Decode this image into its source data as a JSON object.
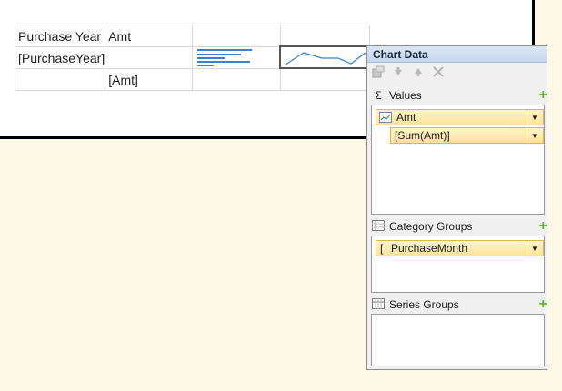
{
  "tablix": {
    "header": {
      "year": "Purchase Year",
      "amt": "Amt"
    },
    "row_group": {
      "year_expr": "[PurchaseYear]"
    },
    "detail": {
      "amt_expr": "[Amt]"
    }
  },
  "chart_data_panel": {
    "title": "Chart Data",
    "toolbar_icons": [
      "properties-icon",
      "move-down-icon",
      "move-up-icon",
      "delete-icon"
    ],
    "values": {
      "label": "Values",
      "field_name": "Amt",
      "field_expr": "[Sum(Amt)]"
    },
    "category_groups": {
      "label": "Category Groups",
      "field_prefix": "[",
      "field_name": "PurchaseMonth"
    },
    "series_groups": {
      "label": "Series Groups"
    }
  },
  "colors": {
    "bar_accent": "#3a82d8",
    "add_green": "#5cb82d",
    "field_fill": "#fbe39a"
  }
}
